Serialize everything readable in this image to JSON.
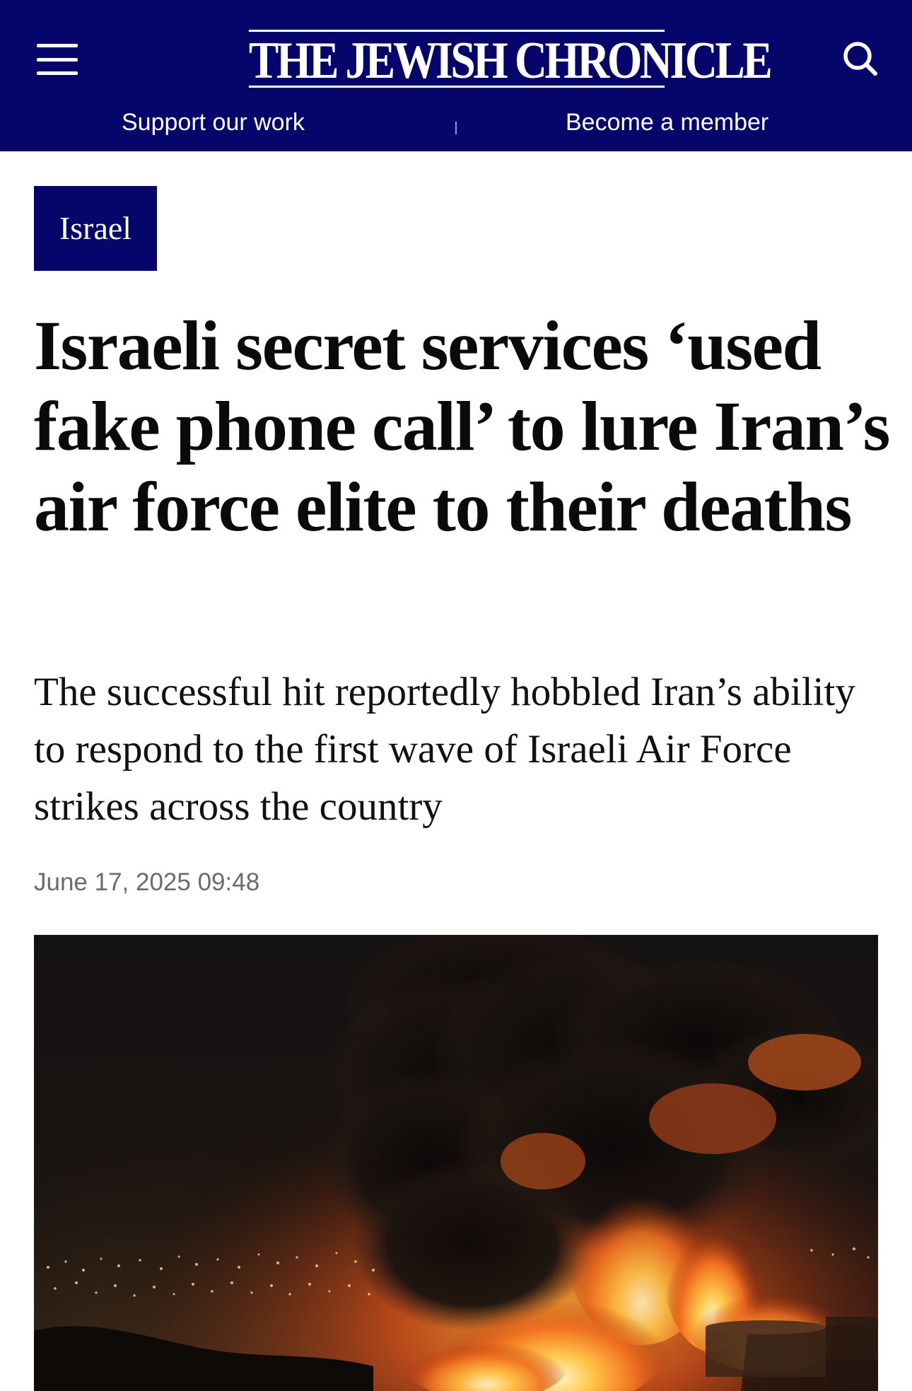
{
  "header": {
    "logo_text": "THE JEWISH CHRONICLE",
    "menu_icon": "hamburger-menu-icon",
    "search_icon": "search-icon",
    "background_color": "#05056b"
  },
  "subnav": {
    "support_label": "Support our work",
    "member_label": "Become a member"
  },
  "article": {
    "category": "Israel",
    "headline": "Israeli secret services ‘used fake phone call’ to lure Iran’s air force elite to their deaths",
    "standfirst": "The successful hit reportedly hobbled Iran’s ability to respond to the first wave of Israeli Air Force strikes across the country",
    "timestamp": "June 17, 2025 09:48"
  },
  "hero_image": {
    "subject": "night-fire-smoke-city-photo"
  }
}
